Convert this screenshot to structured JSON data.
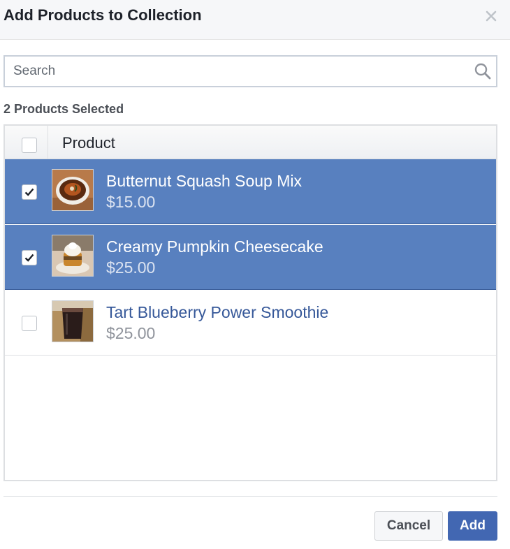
{
  "dialog": {
    "title": "Add Products to Collection"
  },
  "search": {
    "placeholder": "Search",
    "value": ""
  },
  "selection": {
    "summary": "2 Products Selected"
  },
  "table": {
    "column_header": "Product",
    "rows": [
      {
        "name": "Butternut Squash Soup Mix",
        "price": "$15.00",
        "selected": true
      },
      {
        "name": "Creamy Pumpkin Cheesecake",
        "price": "$25.00",
        "selected": true
      },
      {
        "name": "Tart Blueberry Power Smoothie",
        "price": "$25.00",
        "selected": false
      }
    ]
  },
  "footer": {
    "cancel_label": "Cancel",
    "add_label": "Add"
  },
  "colors": {
    "selected_row": "#5880bf",
    "primary_button": "#4267b2",
    "link_text": "#365899"
  },
  "icons": {
    "close": "close-icon",
    "search": "search-icon",
    "check": "checkmark-icon"
  }
}
